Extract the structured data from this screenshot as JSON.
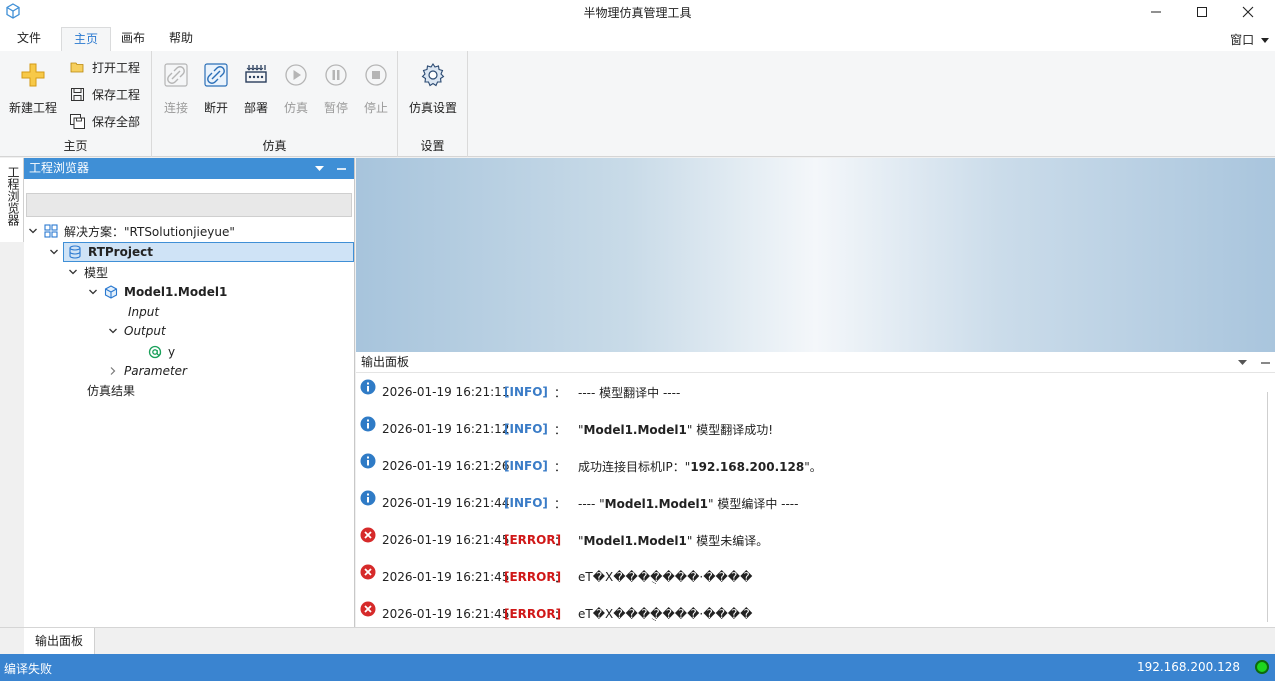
{
  "window": {
    "title": "半物理仿真管理工具"
  },
  "menu": {
    "tabs": [
      {
        "label": "文件"
      },
      {
        "label": "主页"
      },
      {
        "label": "画布"
      },
      {
        "label": "帮助"
      }
    ],
    "active_tab": "主页",
    "window_menu": "窗口"
  },
  "ribbon": {
    "home_group": {
      "label": "主页",
      "new_project": "新建工程",
      "open_project": "打开工程",
      "save_project": "保存工程",
      "save_all": "保存全部"
    },
    "sim_group": {
      "label": "仿真",
      "connect": "连接",
      "disconnect": "断开",
      "deploy": "部署",
      "simulate": "仿真",
      "pause": "暂停",
      "stop": "停止"
    },
    "settings_group": {
      "label": "设置",
      "sim_settings": "仿真设置"
    }
  },
  "side_tab": "工程浏览器",
  "project_browser": {
    "title": "工程浏览器",
    "solution": "解决方案：\"RTSolutionjieyue\"",
    "project": "RTProject",
    "models_folder": "模型",
    "model": "Model1.Model1",
    "input": "Input",
    "output": "Output",
    "variable": "y",
    "parameter": "Parameter",
    "results": "仿真结果"
  },
  "output_panel": {
    "title": "输出面板",
    "logs": [
      {
        "level": "info",
        "time": "2026-01-19 16:21:11",
        "tag": "[INFO]",
        "sep": "：",
        "pre": "---- 模型翻译中 ----",
        "bold": "",
        "post": ""
      },
      {
        "level": "info",
        "time": "2026-01-19 16:21:12",
        "tag": "[INFO]",
        "sep": "：",
        "pre": "\"",
        "bold": "Model1.Model1",
        "post": "\" 模型翻译成功!"
      },
      {
        "level": "info",
        "time": "2026-01-19 16:21:26",
        "tag": "[INFO]",
        "sep": "：",
        "pre": "成功连接目标机IP：\"",
        "bold": "192.168.200.128",
        "post": "\"。"
      },
      {
        "level": "info",
        "time": "2026-01-19 16:21:44",
        "tag": "[INFO]",
        "sep": "：",
        "pre": "---- \"",
        "bold": "Model1.Model1",
        "post": "\" 模型编译中 ----"
      },
      {
        "level": "error",
        "time": "2026-01-19 16:21:45",
        "tag": "[ERROR]",
        "sep": "：",
        "pre": "\"",
        "bold": "Model1.Model1",
        "post": "\" 模型未编译。"
      },
      {
        "level": "error",
        "time": "2026-01-19 16:21:45",
        "tag": "[ERROR]",
        "sep": "：",
        "pre": "еТ�Х���ֻ����·����",
        "bold": "",
        "post": ""
      },
      {
        "level": "error",
        "time": "2026-01-19 16:21:45",
        "tag": "[ERROR]",
        "sep": "：",
        "pre": "еТ�Х���ֻ����·����",
        "bold": "",
        "post": ""
      }
    ]
  },
  "bottom_tab": "输出面板",
  "status": {
    "message": "编译失败",
    "ip": "192.168.200.128",
    "connected_color": "#1ed61e"
  },
  "colors": {
    "accent": "#3f8fd6",
    "statusbar": "#3a84d0",
    "info": "#3a7cc7",
    "error": "#d01818"
  }
}
